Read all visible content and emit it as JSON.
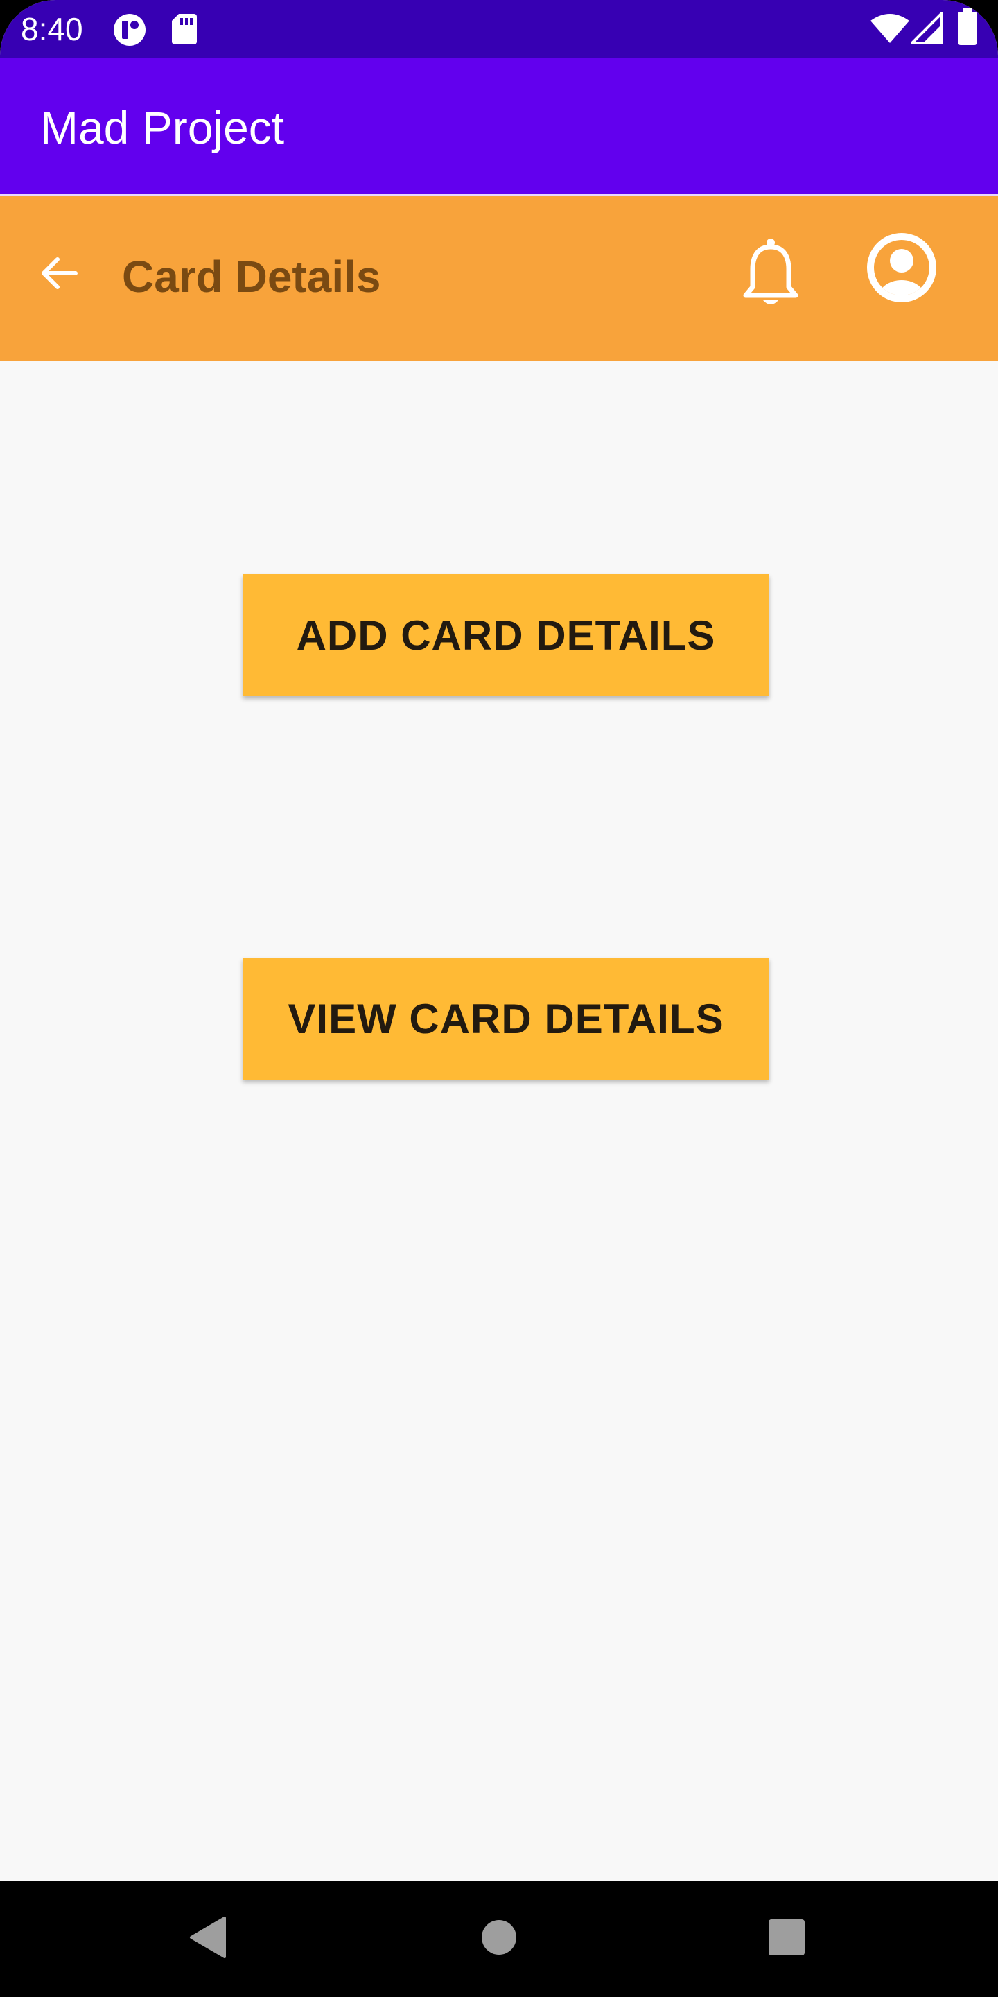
{
  "status_bar": {
    "time": "8:40",
    "left_icons": [
      "nfc-icon",
      "sd-card-icon"
    ],
    "right_icons": [
      "wifi-icon",
      "signal-icon",
      "battery-icon"
    ]
  },
  "app_bar": {
    "title": "Mad Project",
    "background": "#6200ee"
  },
  "toolbar": {
    "title": "Card Details",
    "background": "#f8a33b",
    "icons": [
      "back-arrow-icon",
      "bell-icon",
      "account-circle-icon"
    ]
  },
  "main": {
    "add_button_label": "ADD CARD DETAILS",
    "view_button_label": "VIEW CARD DETAILS",
    "button_color": "#ffba35"
  },
  "nav_bar": {
    "icons": [
      "back-triangle-icon",
      "home-circle-icon",
      "recents-square-icon"
    ]
  }
}
